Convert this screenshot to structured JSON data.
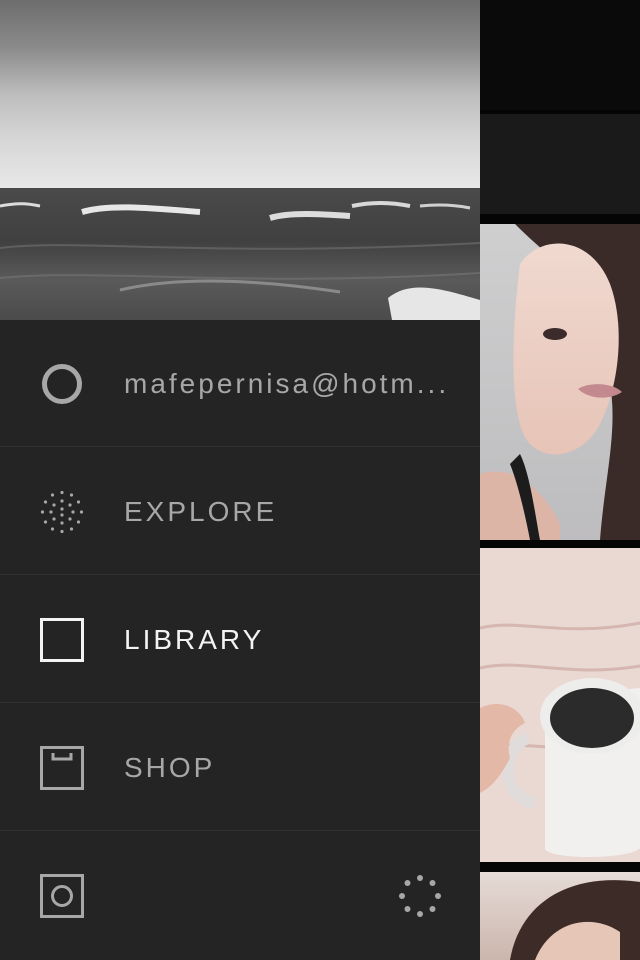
{
  "drawer": {
    "account_email": "mafepernisa@hotm...",
    "items": [
      {
        "label": "EXPLORE",
        "icon": "explore-dots-icon",
        "active": false
      },
      {
        "label": "LIBRARY",
        "icon": "library-square-icon",
        "active": true
      },
      {
        "label": "SHOP",
        "icon": "shop-box-icon",
        "active": false
      }
    ],
    "bottom_icons": [
      "camera-icon",
      "loading-spinner-icon"
    ]
  },
  "colors": {
    "drawer_bg": "#242424",
    "inactive_text": "#a7a7a7",
    "active_text": "#f3f3f3",
    "divider": "#2f2f2f"
  }
}
